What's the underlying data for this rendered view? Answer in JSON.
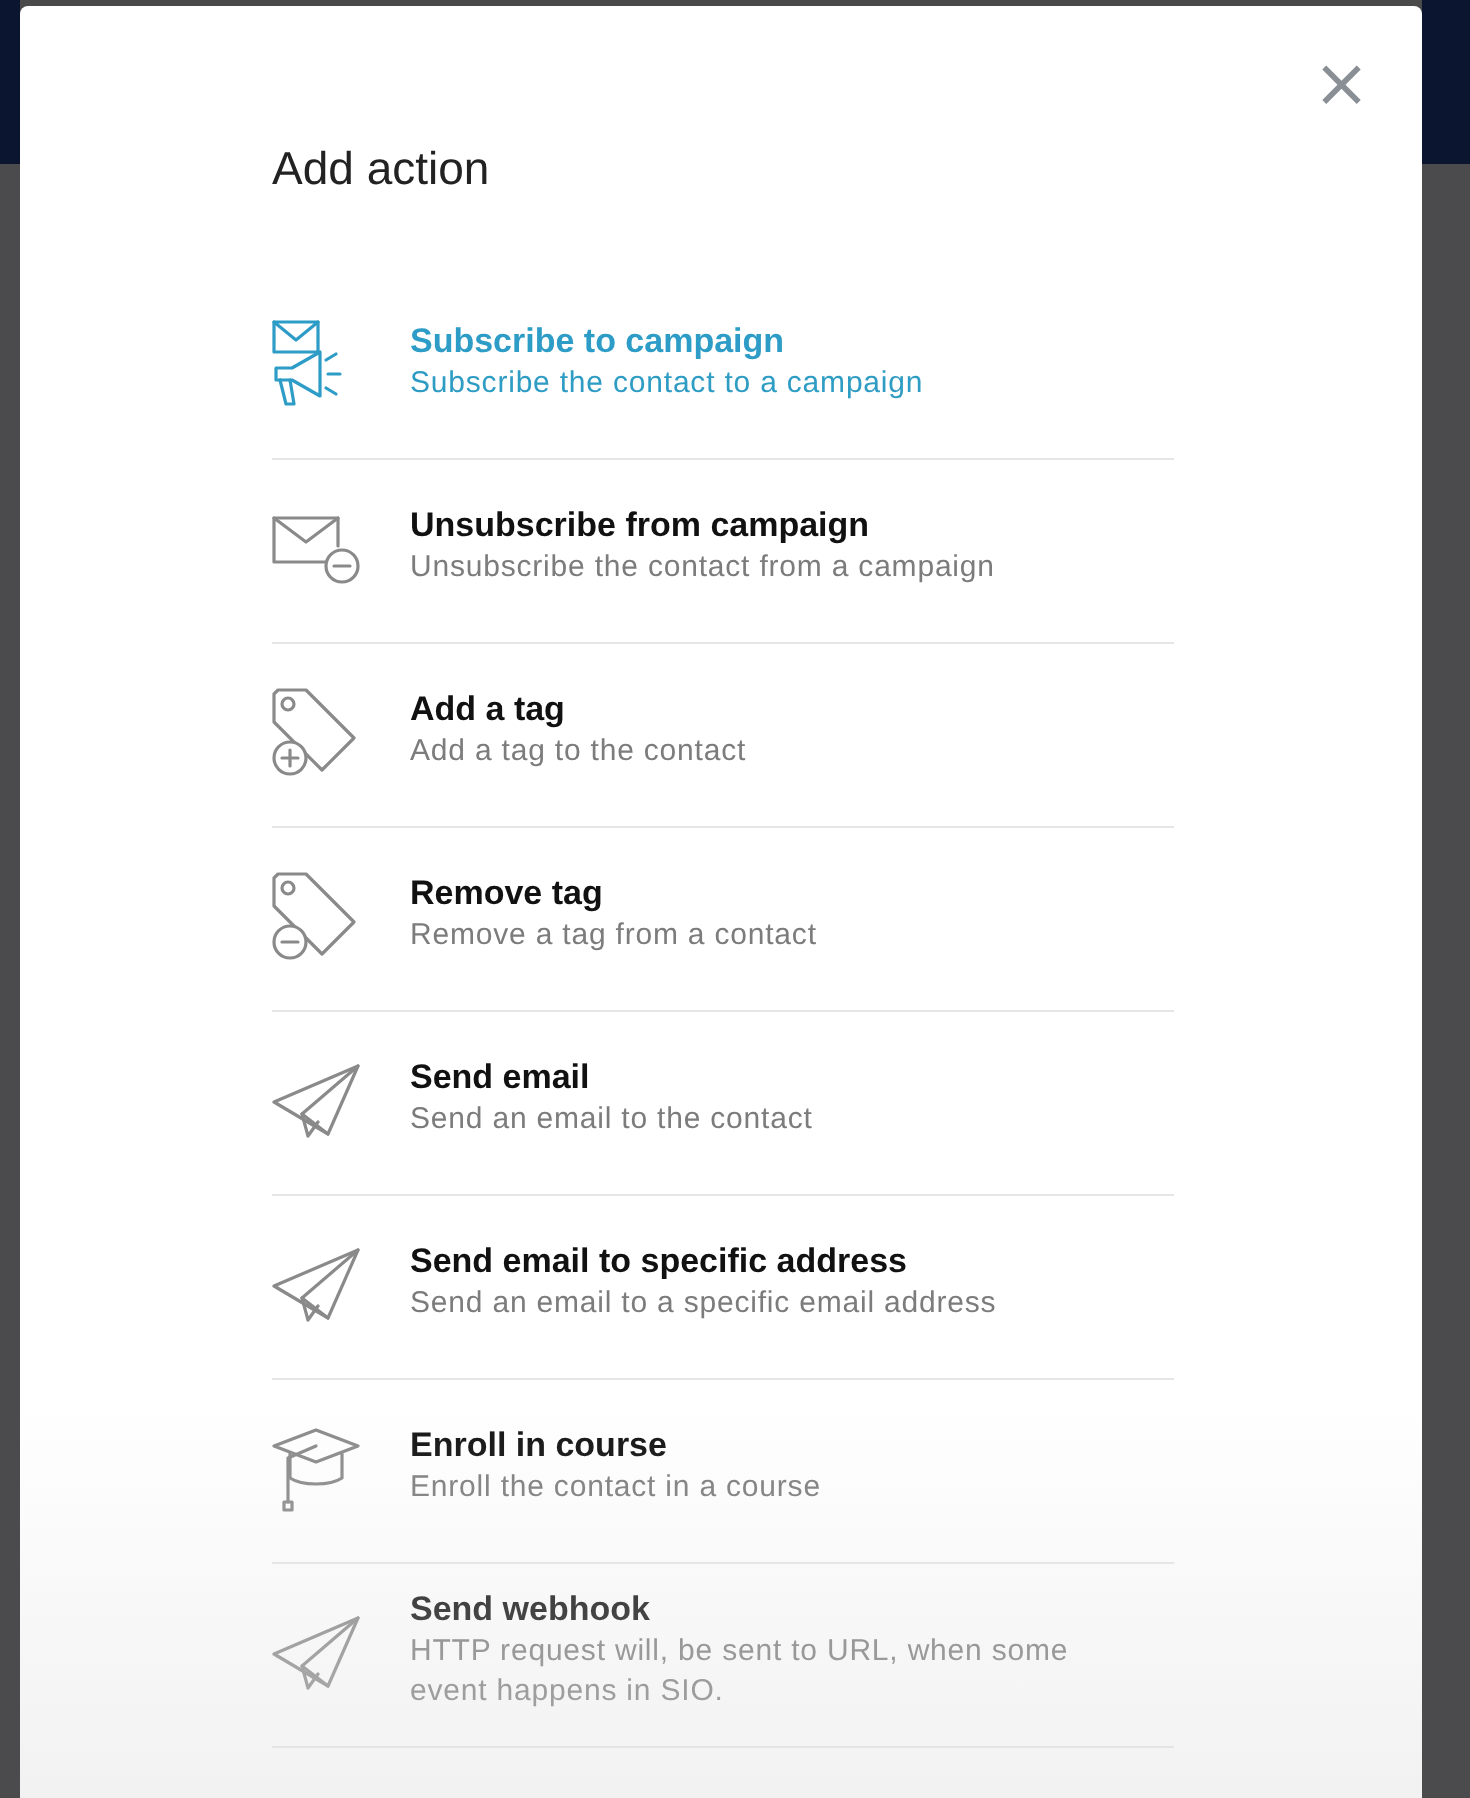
{
  "dialog": {
    "title": "Add action",
    "close": "×",
    "actions": [
      {
        "kind": "subscribe",
        "title": "Subscribe to campaign",
        "description": "Subscribe the contact to a campaign",
        "selected": true
      },
      {
        "kind": "unsubscribe",
        "title": "Unsubscribe from campaign",
        "description": "Unsubscribe the contact from a campaign",
        "selected": false
      },
      {
        "kind": "tag-add",
        "title": "Add a tag",
        "description": "Add a tag to the contact",
        "selected": false
      },
      {
        "kind": "tag-remove",
        "title": "Remove tag",
        "description": "Remove a tag from a contact",
        "selected": false
      },
      {
        "kind": "send",
        "title": "Send email",
        "description": "Send an email to the contact",
        "selected": false
      },
      {
        "kind": "send",
        "title": "Send email to specific address",
        "description": "Send an email to a specific email address",
        "selected": false
      },
      {
        "kind": "course",
        "title": "Enroll in course",
        "description": "Enroll the contact in a course",
        "selected": false
      },
      {
        "kind": "send",
        "title": "Send webhook",
        "description": "HTTP request will, be sent to URL, when some event happens in SIO.",
        "selected": false
      }
    ]
  }
}
